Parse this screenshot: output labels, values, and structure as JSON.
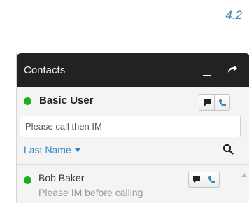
{
  "version_label": "4.2",
  "panel": {
    "title": "Contacts",
    "minimize_icon": "minimize-icon",
    "popout_icon": "popout-arrow-icon"
  },
  "current_user": {
    "name": "Basic User",
    "presence": "available",
    "presence_color": "#1fae1f",
    "status_message": "Please call then IM"
  },
  "sort": {
    "label": "Last Name"
  },
  "contacts": [
    {
      "name": "Bob Baker",
      "note": "Please IM before calling",
      "presence": "available"
    }
  ],
  "colors": {
    "accent": "#2e86c8",
    "titlebar": "#222222",
    "version": "#3a87bd"
  }
}
